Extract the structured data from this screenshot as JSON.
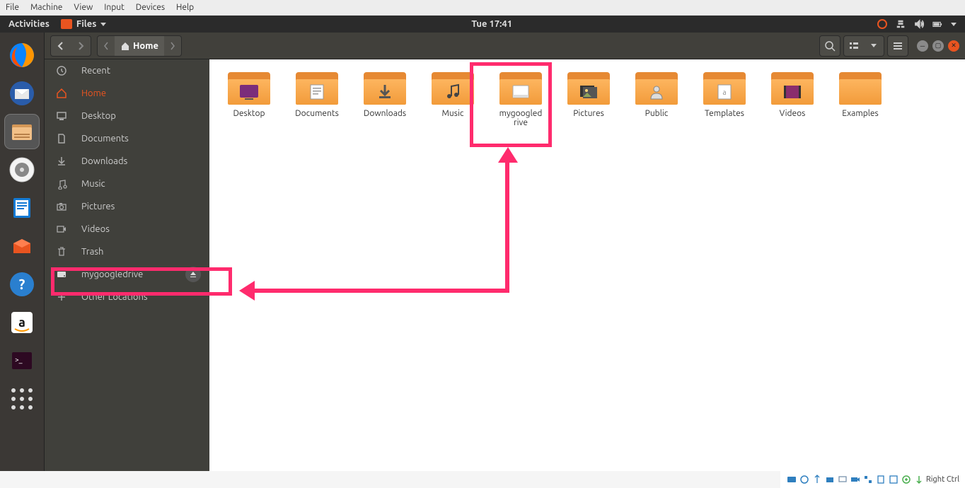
{
  "vm_menu": {
    "file": "File",
    "machine": "Machine",
    "view": "View",
    "input": "Input",
    "devices": "Devices",
    "help": "Help"
  },
  "topbar": {
    "activities": "Activities",
    "app_name": "Files",
    "clock": "Tue 17:41"
  },
  "toolbar": {
    "path_home": "Home"
  },
  "sidebar": {
    "recent": "Recent",
    "home": "Home",
    "desktop": "Desktop",
    "documents": "Documents",
    "downloads": "Downloads",
    "music": "Music",
    "pictures": "Pictures",
    "videos": "Videos",
    "trash": "Trash",
    "drive": "mygoogledrive",
    "other": "Other Locations"
  },
  "folders": {
    "desktop": "Desktop",
    "documents": "Documents",
    "downloads": "Downloads",
    "music": "Music",
    "mygoogledrive_l1": "mygoogled",
    "mygoogledrive_l2": "rive",
    "pictures": "Pictures",
    "public": "Public",
    "templates": "Templates",
    "videos": "Videos",
    "examples": "Examples"
  },
  "statusbar": {
    "right_ctrl": "Right Ctrl"
  }
}
